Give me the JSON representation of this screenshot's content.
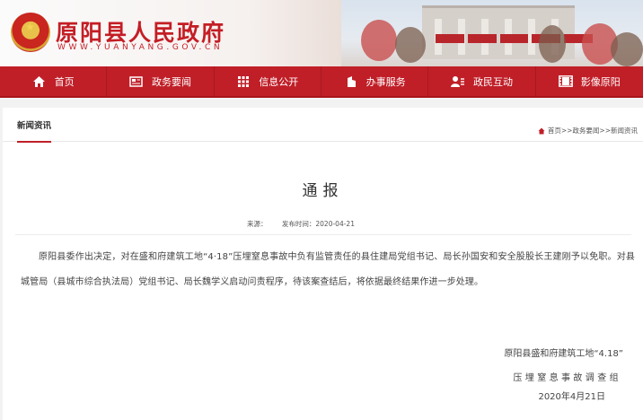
{
  "header": {
    "site_title": "原阳县人民政府",
    "site_domain": "WWW.YUANYANG.GOV.CN"
  },
  "nav": {
    "items": [
      {
        "label": "首页",
        "icon": "home-icon"
      },
      {
        "label": "政务要闻",
        "icon": "newspaper-icon"
      },
      {
        "label": "信息公开",
        "icon": "grid-icon"
      },
      {
        "label": "办事服务",
        "icon": "building-icon"
      },
      {
        "label": "政民互动",
        "icon": "user-icon"
      },
      {
        "label": "影像原阳",
        "icon": "film-icon"
      }
    ]
  },
  "section": {
    "tab_label": "新闻资讯",
    "breadcrumb": "首页>>政务要闻>>新闻资讯"
  },
  "article": {
    "title": "通报",
    "source_label": "来源：",
    "date_label": "发布时间：",
    "date": "2020-04-21",
    "body": "原阳县委作出决定，对在盛和府建筑工地“4·18”压埋窒息事故中负有监管责任的县住建局党组书记、局长孙国安和安全股股长王建刚予以免职。对县城管局（县城市综合执法局）党组书记、局长魏学义启动问责程序，待该案查结后，将依据最终结果作进一步处理。",
    "signature_line1": "原阳县盛和府建筑工地“4.18”",
    "signature_line2": "压埋窒息事故调查组",
    "signature_date": "2020年4月21日"
  },
  "colors": {
    "brand_red": "#c01f28",
    "title_red": "#c41e25"
  }
}
